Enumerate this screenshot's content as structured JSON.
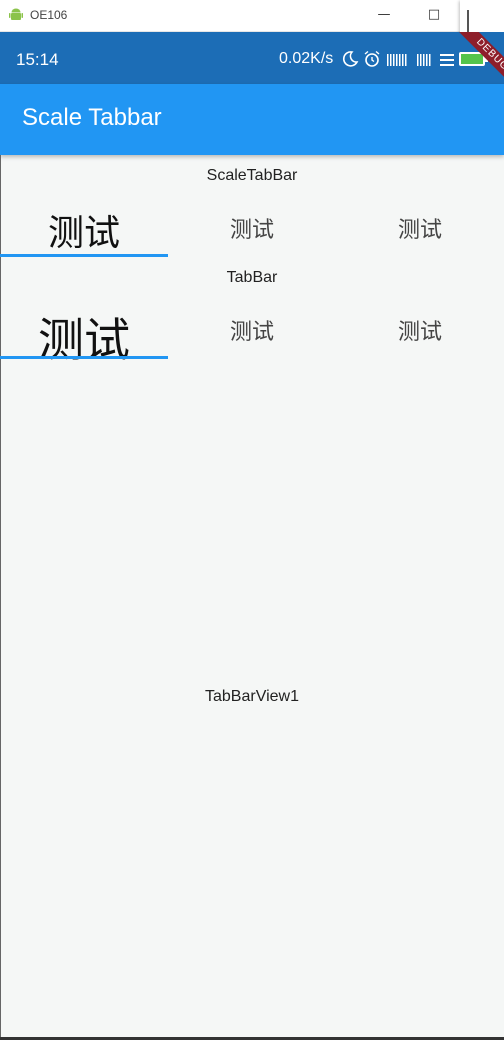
{
  "window": {
    "title": "OE106"
  },
  "status_bar": {
    "time": "15:14",
    "net_speed": "0.02K/s",
    "debug_ribbon": "DEBUG",
    "color": "#1c6db6"
  },
  "app_bar": {
    "title": "Scale Tabbar",
    "color": "#2196f3"
  },
  "scale_tab_bar": {
    "label": "ScaleTabBar",
    "tabs": [
      {
        "label": "测试",
        "selected": true
      },
      {
        "label": "测试",
        "selected": false
      },
      {
        "label": "测试",
        "selected": false
      }
    ]
  },
  "tab_bar": {
    "label": "TabBar",
    "tabs": [
      {
        "label": "测试",
        "selected": true
      },
      {
        "label": "测试",
        "selected": false
      },
      {
        "label": "测试",
        "selected": false
      }
    ]
  },
  "tab_view": {
    "label": "TabBarView1"
  },
  "colors": {
    "indicator": "#2196f3",
    "background": "#f5f7f6"
  }
}
